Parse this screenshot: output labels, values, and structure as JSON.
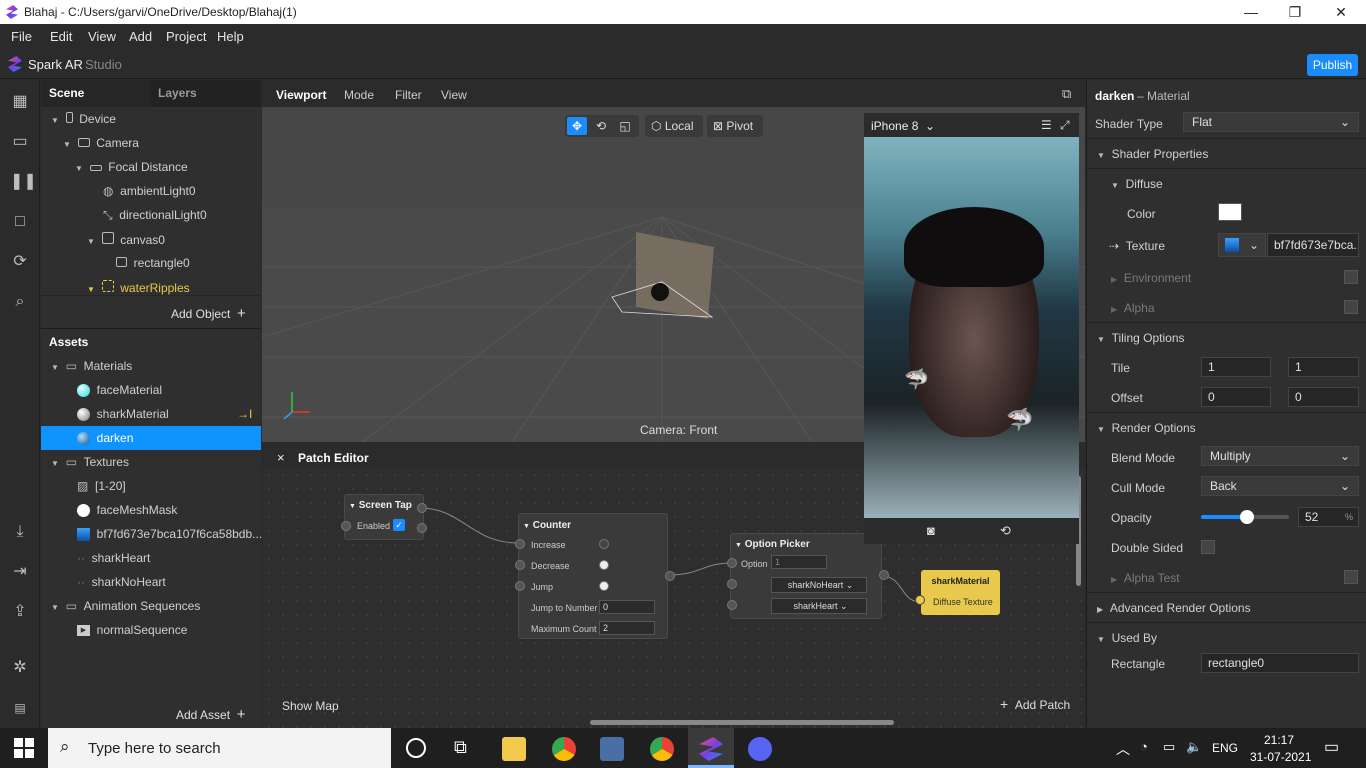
{
  "window": {
    "title": "Blahaj - C:/Users/garvi/OneDrive/Desktop/Blahaj(1)",
    "min": "—",
    "max": "❐",
    "close": "✕"
  },
  "menu": [
    "File",
    "Edit",
    "View",
    "Add",
    "Project",
    "Help"
  ],
  "brand": {
    "name": "Spark AR",
    "suffix": "Studio",
    "publish": "Publish"
  },
  "scene": {
    "tab_scene": "Scene",
    "tab_layers": "Layers",
    "items": [
      "Device",
      "Camera",
      "Focal Distance",
      "ambientLight0",
      "directionalLight0",
      "canvas0",
      "rectangle0",
      "waterRipples"
    ],
    "add_object": "Add Object"
  },
  "assets": {
    "title": "Assets",
    "items": [
      "Materials",
      "faceMaterial",
      "sharkMaterial",
      "darken",
      "Textures",
      "[1-20]",
      "faceMeshMask",
      "bf7fd673e7bca107f6ca58bdb...",
      "sharkHeart",
      "sharkNoHeart",
      "Animation Sequences",
      "normalSequence"
    ],
    "add_asset": "Add Asset"
  },
  "viewport": {
    "tabs": [
      "Viewport",
      "Mode",
      "Filter",
      "View"
    ],
    "local": "Local",
    "pivot": "Pivot",
    "camera_label": "Camera: Front"
  },
  "simulator": {
    "device": "iPhone 8"
  },
  "patch": {
    "title": "Patch Editor",
    "show_map": "Show Map",
    "add_patch": "Add Patch",
    "screen_tap": {
      "title": "Screen Tap",
      "enabled": "Enabled"
    },
    "counter": {
      "title": "Counter",
      "increase": "Increase",
      "decrease": "Decrease",
      "jump": "Jump",
      "jump_to": "Jump to Number",
      "jump_val": "0",
      "max": "Maximum Count",
      "max_val": "2"
    },
    "option_picker": {
      "title": "Option Picker",
      "option": "Option",
      "option_val": "1",
      "opt1": "sharkNoHeart",
      "opt2": "sharkHeart"
    },
    "shark_material": {
      "title": "sharkMaterial",
      "port": "Diffuse Texture"
    }
  },
  "inspector": {
    "name": "darken",
    "type": "– Material",
    "shader_type_label": "Shader Type",
    "shader_type": "Flat",
    "shader_props": "Shader Properties",
    "diffuse": "Diffuse",
    "color": "Color",
    "texture": "Texture",
    "texture_val": "bf7fd673e7bca...",
    "environment": "Environment",
    "alpha": "Alpha",
    "tiling": "Tiling Options",
    "tile": "Tile",
    "tile_x": "1",
    "tile_y": "1",
    "offset": "Offset",
    "off_x": "0",
    "off_y": "0",
    "render": "Render Options",
    "blend_label": "Blend Mode",
    "blend": "Multiply",
    "cull_label": "Cull Mode",
    "cull": "Back",
    "opacity_label": "Opacity",
    "opacity": "52",
    "opacity_unit": "%",
    "double_sided": "Double Sided",
    "alpha_test": "Alpha Test",
    "adv": "Advanced Render Options",
    "used_by": "Used By",
    "used_label": "Rectangle",
    "used_val": "rectangle0"
  },
  "taskbar": {
    "search": "Type here to search",
    "lang": "ENG",
    "time": "21:17",
    "date": "31-07-2021"
  },
  "colors": {
    "accent": "#1a8cff",
    "selected": "#0f93ff",
    "waterRipples": "#e8c94b"
  }
}
